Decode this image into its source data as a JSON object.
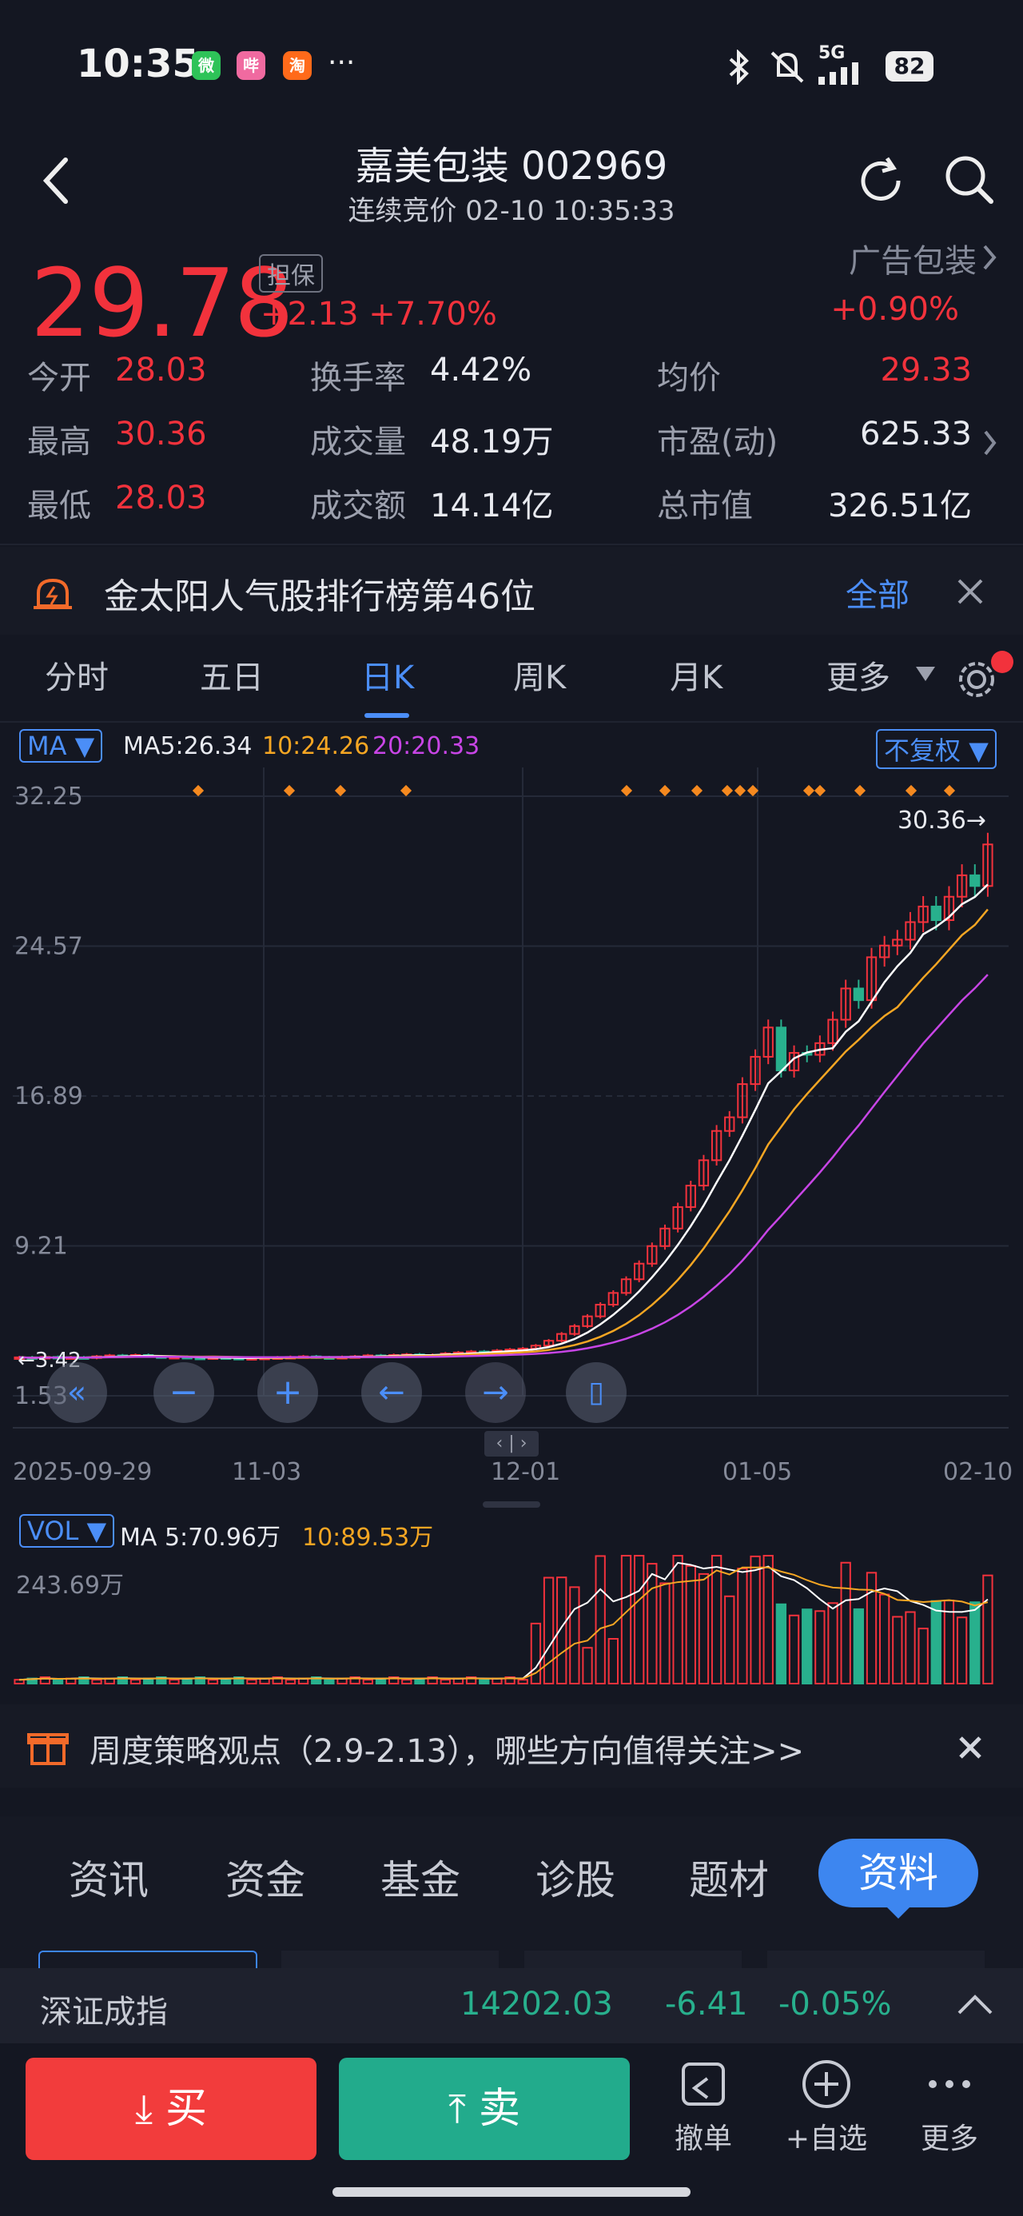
{
  "status": {
    "time": "10:35",
    "apps": [
      "微",
      "哔",
      "淘"
    ],
    "more": "···",
    "network": "5G",
    "battery": "82"
  },
  "header": {
    "title": "嘉美包装 002969",
    "subtitle": "连续竞价 02-10 10:35:33"
  },
  "quote": {
    "price": "29.78",
    "tag": "担保",
    "change": "+2.13",
    "change_pct": "+7.70%",
    "sector": "广告包装",
    "sector_pct": "+0.90%",
    "rows": [
      {
        "l1": "今开",
        "v1": "28.03",
        "l2": "换手率",
        "v2": "4.42%",
        "l3": "均价",
        "v3": "29.33"
      },
      {
        "l1": "最高",
        "v1": "30.36",
        "l2": "成交量",
        "v2": "48.19万",
        "l3": "市盈(动)",
        "v3": "625.33"
      },
      {
        "l1": "最低",
        "v1": "28.03",
        "l2": "成交额",
        "v2": "14.14亿",
        "l3": "总市值",
        "v3": "326.51亿"
      }
    ]
  },
  "notice": {
    "text": "金太阳人气股排行榜第46位",
    "link": "全部"
  },
  "tabs": [
    "分时",
    "五日",
    "日K",
    "周K",
    "月K",
    "更多"
  ],
  "chart_legend": {
    "ma_btn": "MA",
    "ma5": "MA5:26.34",
    "ma10": "10:24.26",
    "ma20": "20:20.33",
    "fq": "不复权"
  },
  "chart_data": {
    "type": "candlestick",
    "y_ticks": [
      "32.25",
      "24.57",
      "16.89",
      "9.21",
      "1.53"
    ],
    "x_ticks": [
      "2025-09-29",
      "11-03",
      "12-01",
      "01-05",
      "02-10"
    ],
    "max_label": "30.36→",
    "min_label": "←3.42",
    "ylim": [
      1.53,
      32.25
    ],
    "closes": [
      3.5,
      3.45,
      3.52,
      3.48,
      3.5,
      3.47,
      3.55,
      3.6,
      3.58,
      3.62,
      3.55,
      3.5,
      3.52,
      3.48,
      3.45,
      3.5,
      3.47,
      3.44,
      3.46,
      3.48,
      3.5,
      3.52,
      3.55,
      3.5,
      3.48,
      3.52,
      3.55,
      3.6,
      3.58,
      3.62,
      3.65,
      3.6,
      3.62,
      3.7,
      3.75,
      3.8,
      3.78,
      3.85,
      3.9,
      3.95,
      4.1,
      4.35,
      4.7,
      5.1,
      5.6,
      6.2,
      6.8,
      7.5,
      8.3,
      9.2,
      10.1,
      11.2,
      12.3,
      13.6,
      15.1,
      15.8,
      17.5,
      18.9,
      20.4,
      18.2,
      19.1,
      19.0,
      19.6,
      20.8,
      22.4,
      21.8,
      24.0,
      24.6,
      24.9,
      25.8,
      26.6,
      25.9,
      27.1,
      28.2,
      27.65,
      29.78
    ]
  },
  "vol_legend": {
    "btn": "VOL",
    "ma5": "MA 5:70.96万",
    "ma10": "10:89.53万",
    "max": "243.69万"
  },
  "promo": {
    "text": "周度策略观点（2.9-2.13），哪些方向值得关注>>"
  },
  "sub_tabs": [
    "资讯",
    "资金",
    "基金",
    "诊股",
    "题材",
    "资料"
  ],
  "index_bar": {
    "name": "深证成指",
    "value": "14202.03",
    "change": "-6.41",
    "pct": "-0.05%"
  },
  "bottom": {
    "buy": "买",
    "sell": "卖",
    "cancel": "撤单",
    "watch": "+自选",
    "more": "更多"
  },
  "colors": {
    "up": "#f2323c",
    "down": "#28b08d",
    "accent": "#4b8ef7",
    "ma5": "#ffffff",
    "ma10": "#f5a623",
    "ma20": "#c845e6"
  }
}
